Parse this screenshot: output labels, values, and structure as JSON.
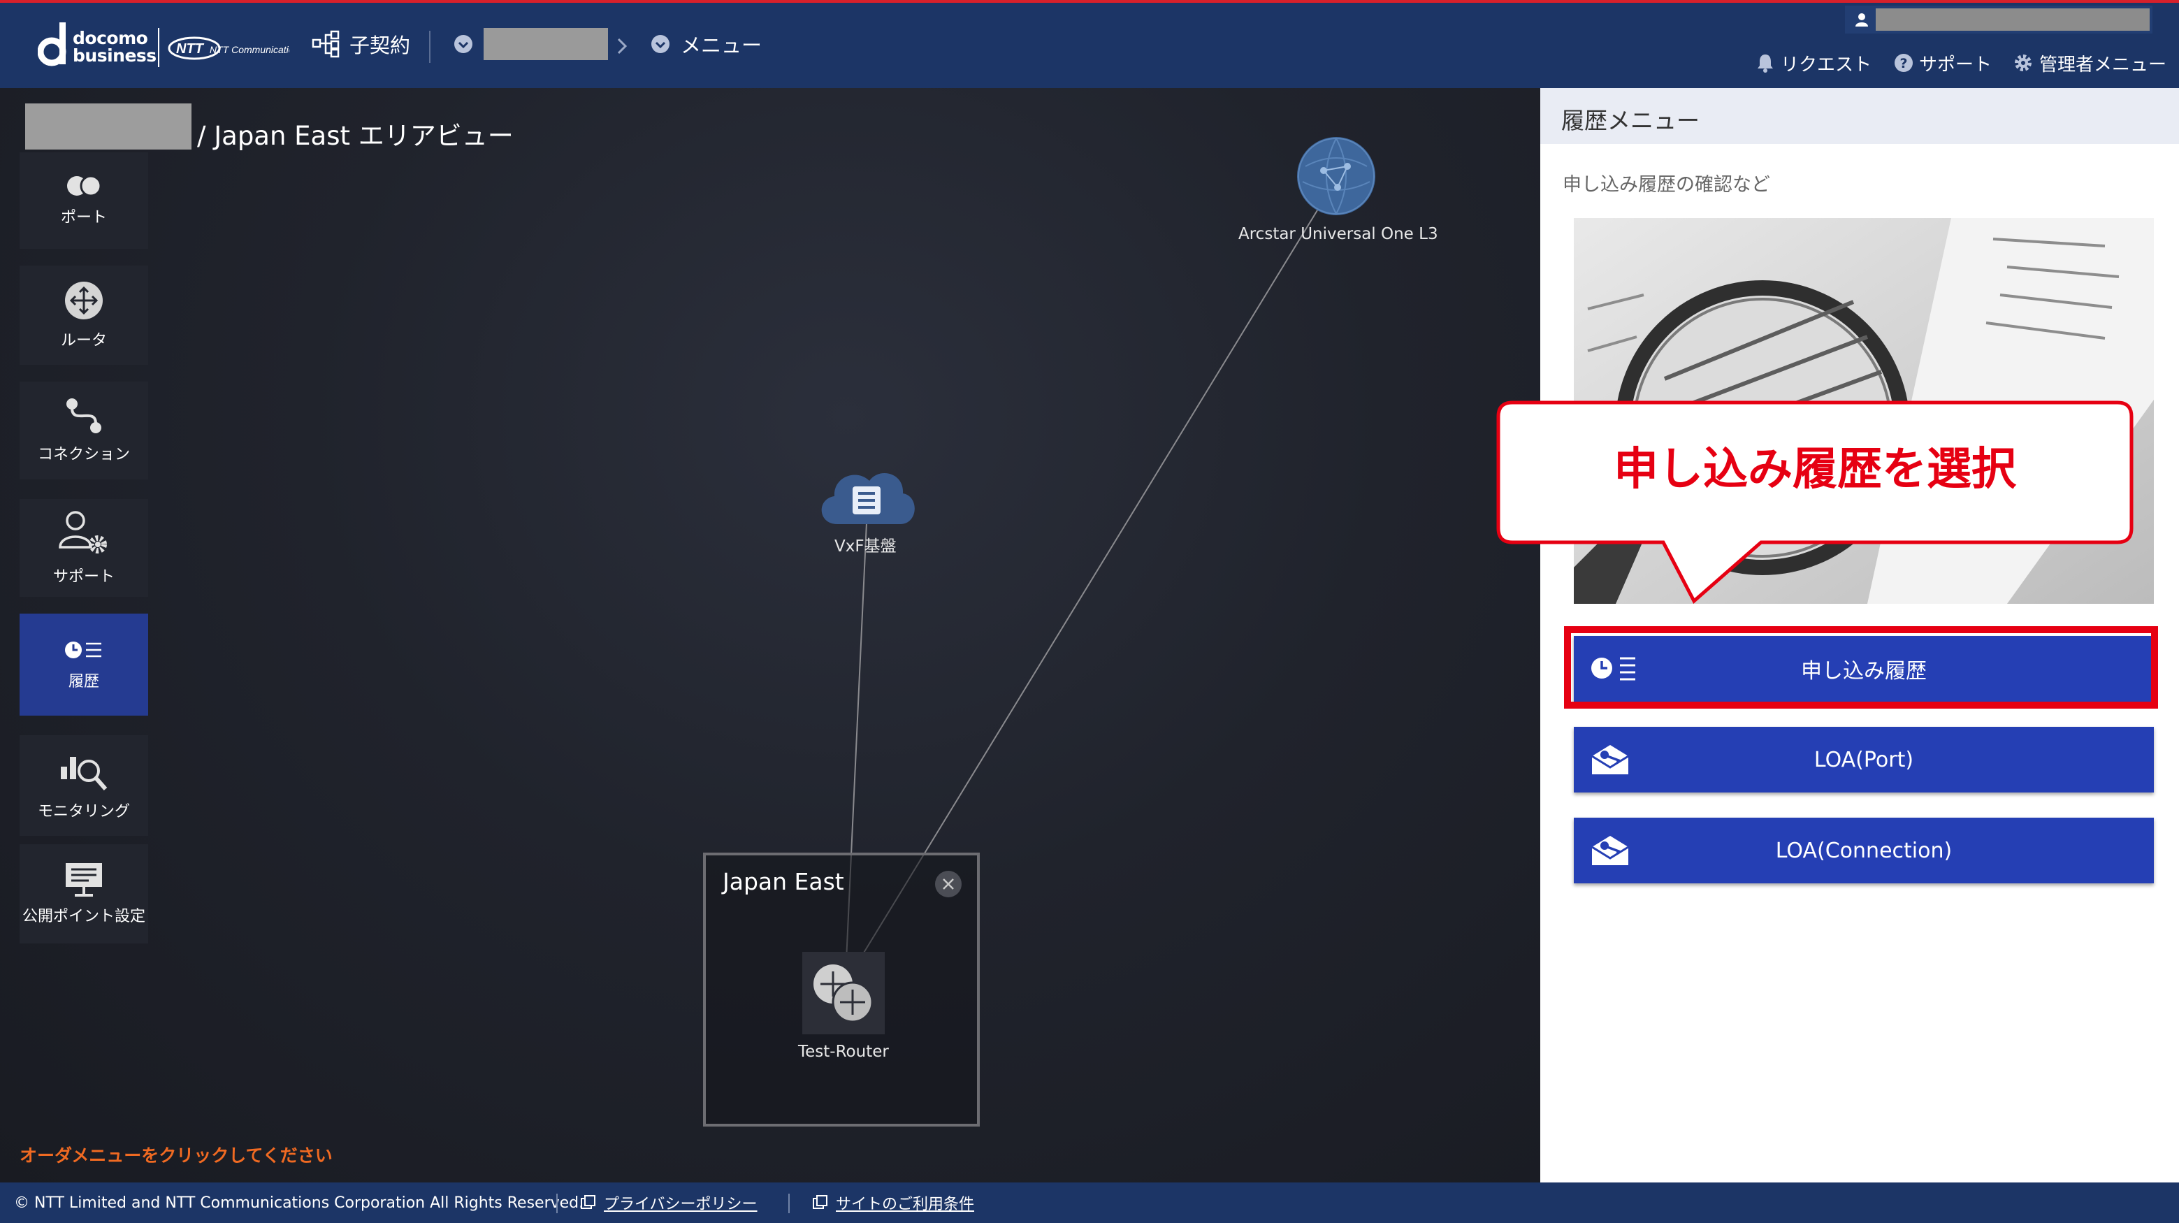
{
  "header": {
    "brand_line1": "docomo",
    "brand_line2": "business",
    "partner_logo": "NTT Communications",
    "sub_contract_label": "子契約",
    "menu_label": "メニュー",
    "request_label": "リクエスト",
    "support_label": "サポート",
    "admin_menu_label": "管理者メニュー"
  },
  "map": {
    "title": "/ Japan East エリアビュー",
    "nodes": {
      "arcstar": "Arcstar Universal One L3",
      "vxf": "VxF基盤",
      "router": "Test-Router"
    },
    "area_name": "Japan East",
    "order_hint": "オーダメニューをクリックしてください"
  },
  "sidebar": {
    "items": [
      {
        "label": "ポート",
        "icon": "port-icon"
      },
      {
        "label": "ルータ",
        "icon": "router-icon"
      },
      {
        "label": "コネクション",
        "icon": "connection-icon"
      },
      {
        "label": "サポート",
        "icon": "support-icon"
      },
      {
        "label": "履歴",
        "icon": "history-icon"
      },
      {
        "label": "モニタリング",
        "icon": "monitoring-icon"
      },
      {
        "label": "公開ポイント設定",
        "icon": "public-point-icon"
      }
    ]
  },
  "panel": {
    "title": "履歴メニュー",
    "subtitle": "申し込み履歴の確認など",
    "buttons": [
      {
        "label": "申し込み履歴",
        "icon": "history-list-icon"
      },
      {
        "label": "LOA(Port)",
        "icon": "envelope-key-icon"
      },
      {
        "label": "LOA(Connection)",
        "icon": "envelope-key-icon"
      }
    ]
  },
  "callout": {
    "text": "申し込み履歴を選択"
  },
  "footer": {
    "copyright": "© NTT Limited and NTT Communications Corporation All Rights Reserved.",
    "privacy": "プライバシーポリシー",
    "terms": "サイトのご利用条件"
  },
  "colors": {
    "header_bg": "#1c3566",
    "accent_blue": "#253fb4",
    "active_sidebar": "#253b91",
    "highlight_red": "#e60012",
    "hint_orange": "#f06a22"
  }
}
